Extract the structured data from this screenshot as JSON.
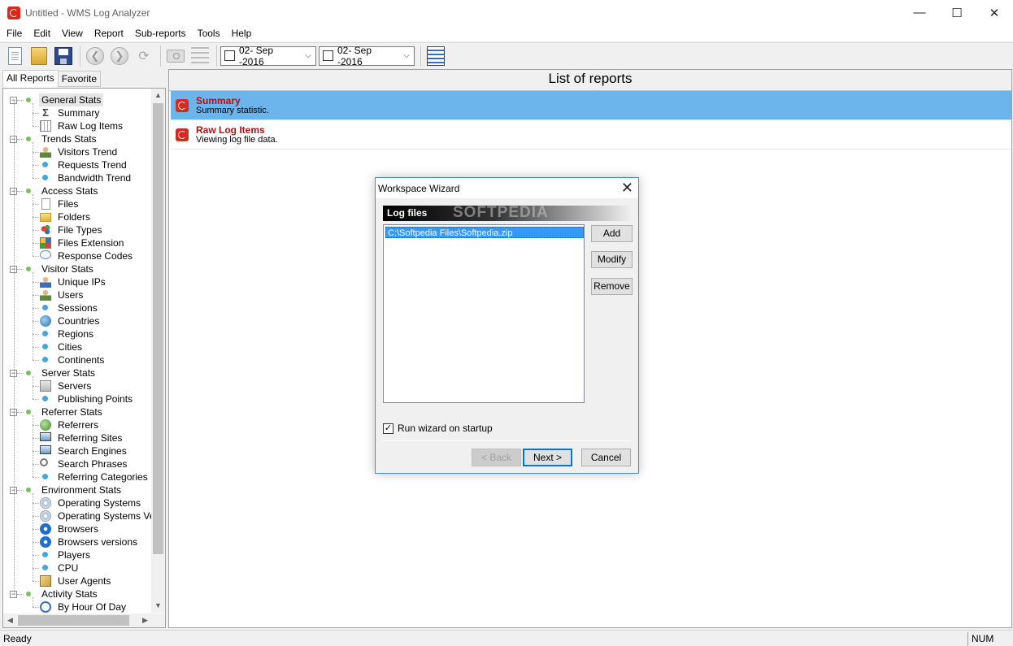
{
  "window": {
    "title": "Untitled - WMS Log Analyzer",
    "controls": {
      "minimize": "—",
      "maximize": "☐",
      "close": "✕"
    }
  },
  "menu": [
    "File",
    "Edit",
    "View",
    "Report",
    "Sub-reports",
    "Tools",
    "Help"
  ],
  "toolbar": {
    "date_from": "02- Sep -2016",
    "date_to": "02- Sep -2016",
    "back_glyph": "❮",
    "forward_glyph": "❯",
    "refresh_glyph": "⟳",
    "dropdown_glyph": "⌵"
  },
  "left_tabs": [
    "All Reports",
    "Favorite"
  ],
  "tree": [
    {
      "label": "General Stats",
      "selected": true,
      "children": [
        {
          "label": "Summary",
          "icon": "sigma-icon"
        },
        {
          "label": "Raw Log Items",
          "icon": "grid-icon"
        }
      ]
    },
    {
      "label": "Trends Stats",
      "children": [
        {
          "label": "Visitors Trend",
          "icon": "person-icon"
        },
        {
          "label": "Requests Trend",
          "icon": "dot-icon"
        },
        {
          "label": "Bandwidth Trend",
          "icon": "dot-icon"
        }
      ]
    },
    {
      "label": "Access Stats",
      "children": [
        {
          "label": "Files",
          "icon": "file-icon"
        },
        {
          "label": "Folders",
          "icon": "folder-icon"
        },
        {
          "label": "File Types",
          "icon": "types-icon"
        },
        {
          "label": "Files Extension",
          "icon": "extension-icon"
        },
        {
          "label": "Response Codes",
          "icon": "bubble-icon"
        }
      ]
    },
    {
      "label": "Visitor Stats",
      "children": [
        {
          "label": "Unique IPs",
          "icon": "person-blue-icon"
        },
        {
          "label": "Users",
          "icon": "person-icon"
        },
        {
          "label": "Sessions",
          "icon": "dot-icon"
        },
        {
          "label": "Countries",
          "icon": "globe-icon"
        },
        {
          "label": "Regions",
          "icon": "dot-icon"
        },
        {
          "label": "Cities",
          "icon": "dot-icon"
        },
        {
          "label": "Continents",
          "icon": "dot-icon"
        }
      ]
    },
    {
      "label": "Server Stats",
      "children": [
        {
          "label": "Servers",
          "icon": "server-icon"
        },
        {
          "label": "Publishing Points",
          "icon": "dot-icon"
        }
      ]
    },
    {
      "label": "Referrer Stats",
      "children": [
        {
          "label": "Referrers",
          "icon": "green-globe-icon"
        },
        {
          "label": "Referring Sites",
          "icon": "monitor-icon"
        },
        {
          "label": "Search Engines",
          "icon": "monitor-icon"
        },
        {
          "label": "Search Phrases",
          "icon": "magnifier-icon"
        },
        {
          "label": "Referring Categories",
          "icon": "dot-icon"
        }
      ]
    },
    {
      "label": "Environment Stats",
      "children": [
        {
          "label": "Operating Systems",
          "icon": "cd-icon"
        },
        {
          "label": "Operating Systems Versio",
          "icon": "cd-icon"
        },
        {
          "label": "Browsers",
          "icon": "ie-icon"
        },
        {
          "label": "Browsers versions",
          "icon": "ie-icon"
        },
        {
          "label": "Players",
          "icon": "dot-icon"
        },
        {
          "label": "CPU",
          "icon": "dot-icon"
        },
        {
          "label": "User Agents",
          "icon": "agent-icon"
        }
      ]
    },
    {
      "label": "Activity Stats",
      "children": [
        {
          "label": "By Hour Of Day",
          "icon": "clock-icon"
        }
      ]
    }
  ],
  "main": {
    "header": "List of reports",
    "reports": [
      {
        "title": "Summary",
        "desc": "Summary statistic.",
        "selected": true
      },
      {
        "title": "Raw Log Items",
        "desc": "Viewing log file data.",
        "selected": false
      }
    ]
  },
  "dialog": {
    "title": "Workspace Wizard",
    "close_glyph": "✕",
    "section": "Log files",
    "watermark": "SOFTPEDIA",
    "files": [
      "C:\\Softpedia Files\\Softpedia.zip"
    ],
    "add_label": "Add",
    "modify_label": "Modify",
    "remove_label": "Remove",
    "checkbox_label": "Run wizard on startup",
    "checkbox_checked": true,
    "back_label": "< Back",
    "next_label": "Next >",
    "cancel_label": "Cancel"
  },
  "status": {
    "text": "Ready",
    "num": "NUM"
  }
}
